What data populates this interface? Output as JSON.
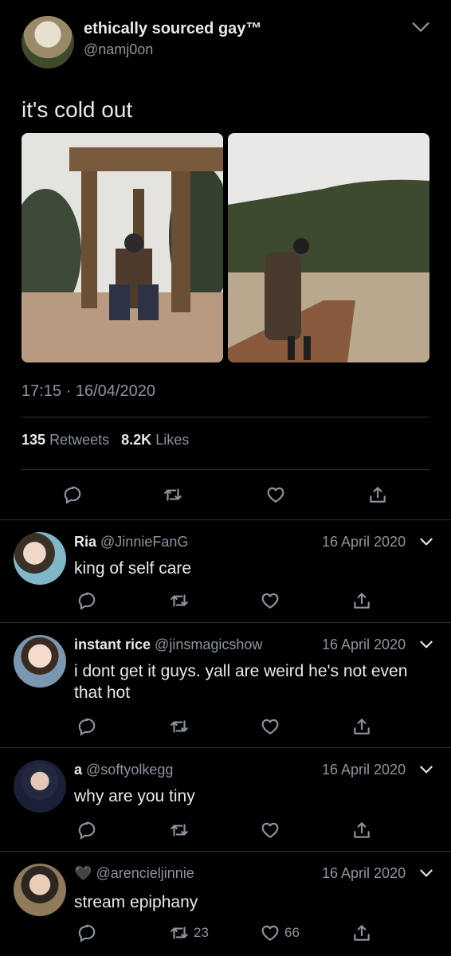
{
  "tweet": {
    "author_name": "ethically sourced gay™",
    "author_handle": "@namj0on",
    "text": "it's cold out",
    "time": "17:15",
    "date": "16/04/2020",
    "retweets_count": "135",
    "retweets_label": "Retweets",
    "likes_count": "8.2K",
    "likes_label": "Likes"
  },
  "replies": [
    {
      "name": "Ria",
      "handle": "@JinnieFanG",
      "date": "16 April 2020",
      "text": "king of self care",
      "retweet_count": "",
      "like_count": ""
    },
    {
      "name": "instant rice",
      "handle": "@jinsmagicshow",
      "date": "16 April 2020",
      "text": "i dont get it guys. yall are weird he's not even that hot",
      "retweet_count": "",
      "like_count": ""
    },
    {
      "name": "a",
      "handle": "@softyolkegg",
      "date": "16 April 2020",
      "text": "why are you tiny",
      "retweet_count": "",
      "like_count": ""
    },
    {
      "name": "🖤",
      "handle": "@arencieljinnie",
      "date": "16 April 2020",
      "text": "stream epiphany",
      "retweet_count": "23",
      "like_count": "66"
    }
  ],
  "icons": {
    "reply": "speech-bubble-icon",
    "retweet": "retweet-arrows-icon",
    "like": "heart-icon",
    "share": "share-arrow-icon",
    "menu": "chevron-down-icon"
  },
  "colors": {
    "background": "#000000",
    "text": "#e7e9ea",
    "muted": "#8b949e",
    "divider": "#2f3336"
  }
}
